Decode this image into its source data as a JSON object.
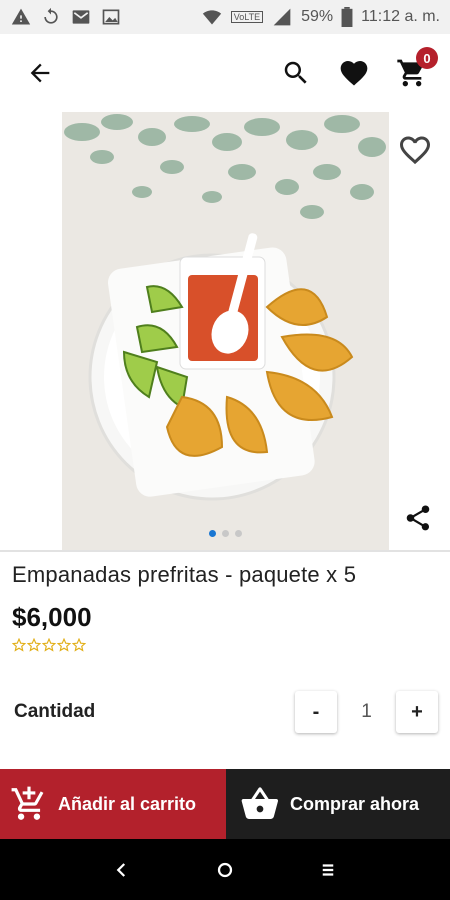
{
  "status_bar": {
    "battery": "59%",
    "time": "11:12 a. m.",
    "network_label": "VoLTE"
  },
  "header": {
    "cart_count": "0"
  },
  "product": {
    "title": "Empanadas prefritas - paquete x 5",
    "price": "$6,000",
    "rating": 0,
    "rating_max": 5,
    "image_icon": "empanadas-photo",
    "gallery_pages": 3,
    "gallery_active_page": 1
  },
  "quantity": {
    "label": "Cantidad",
    "minus": "-",
    "value": "1",
    "plus": "+"
  },
  "actions": {
    "add_to_cart": "Añadir al carrito",
    "buy_now": "Comprar ahora"
  },
  "colors": {
    "brand_red": "#b3212c",
    "dark": "#1e1e1e",
    "star": "#e2b019",
    "dot_active": "#1976d2"
  }
}
